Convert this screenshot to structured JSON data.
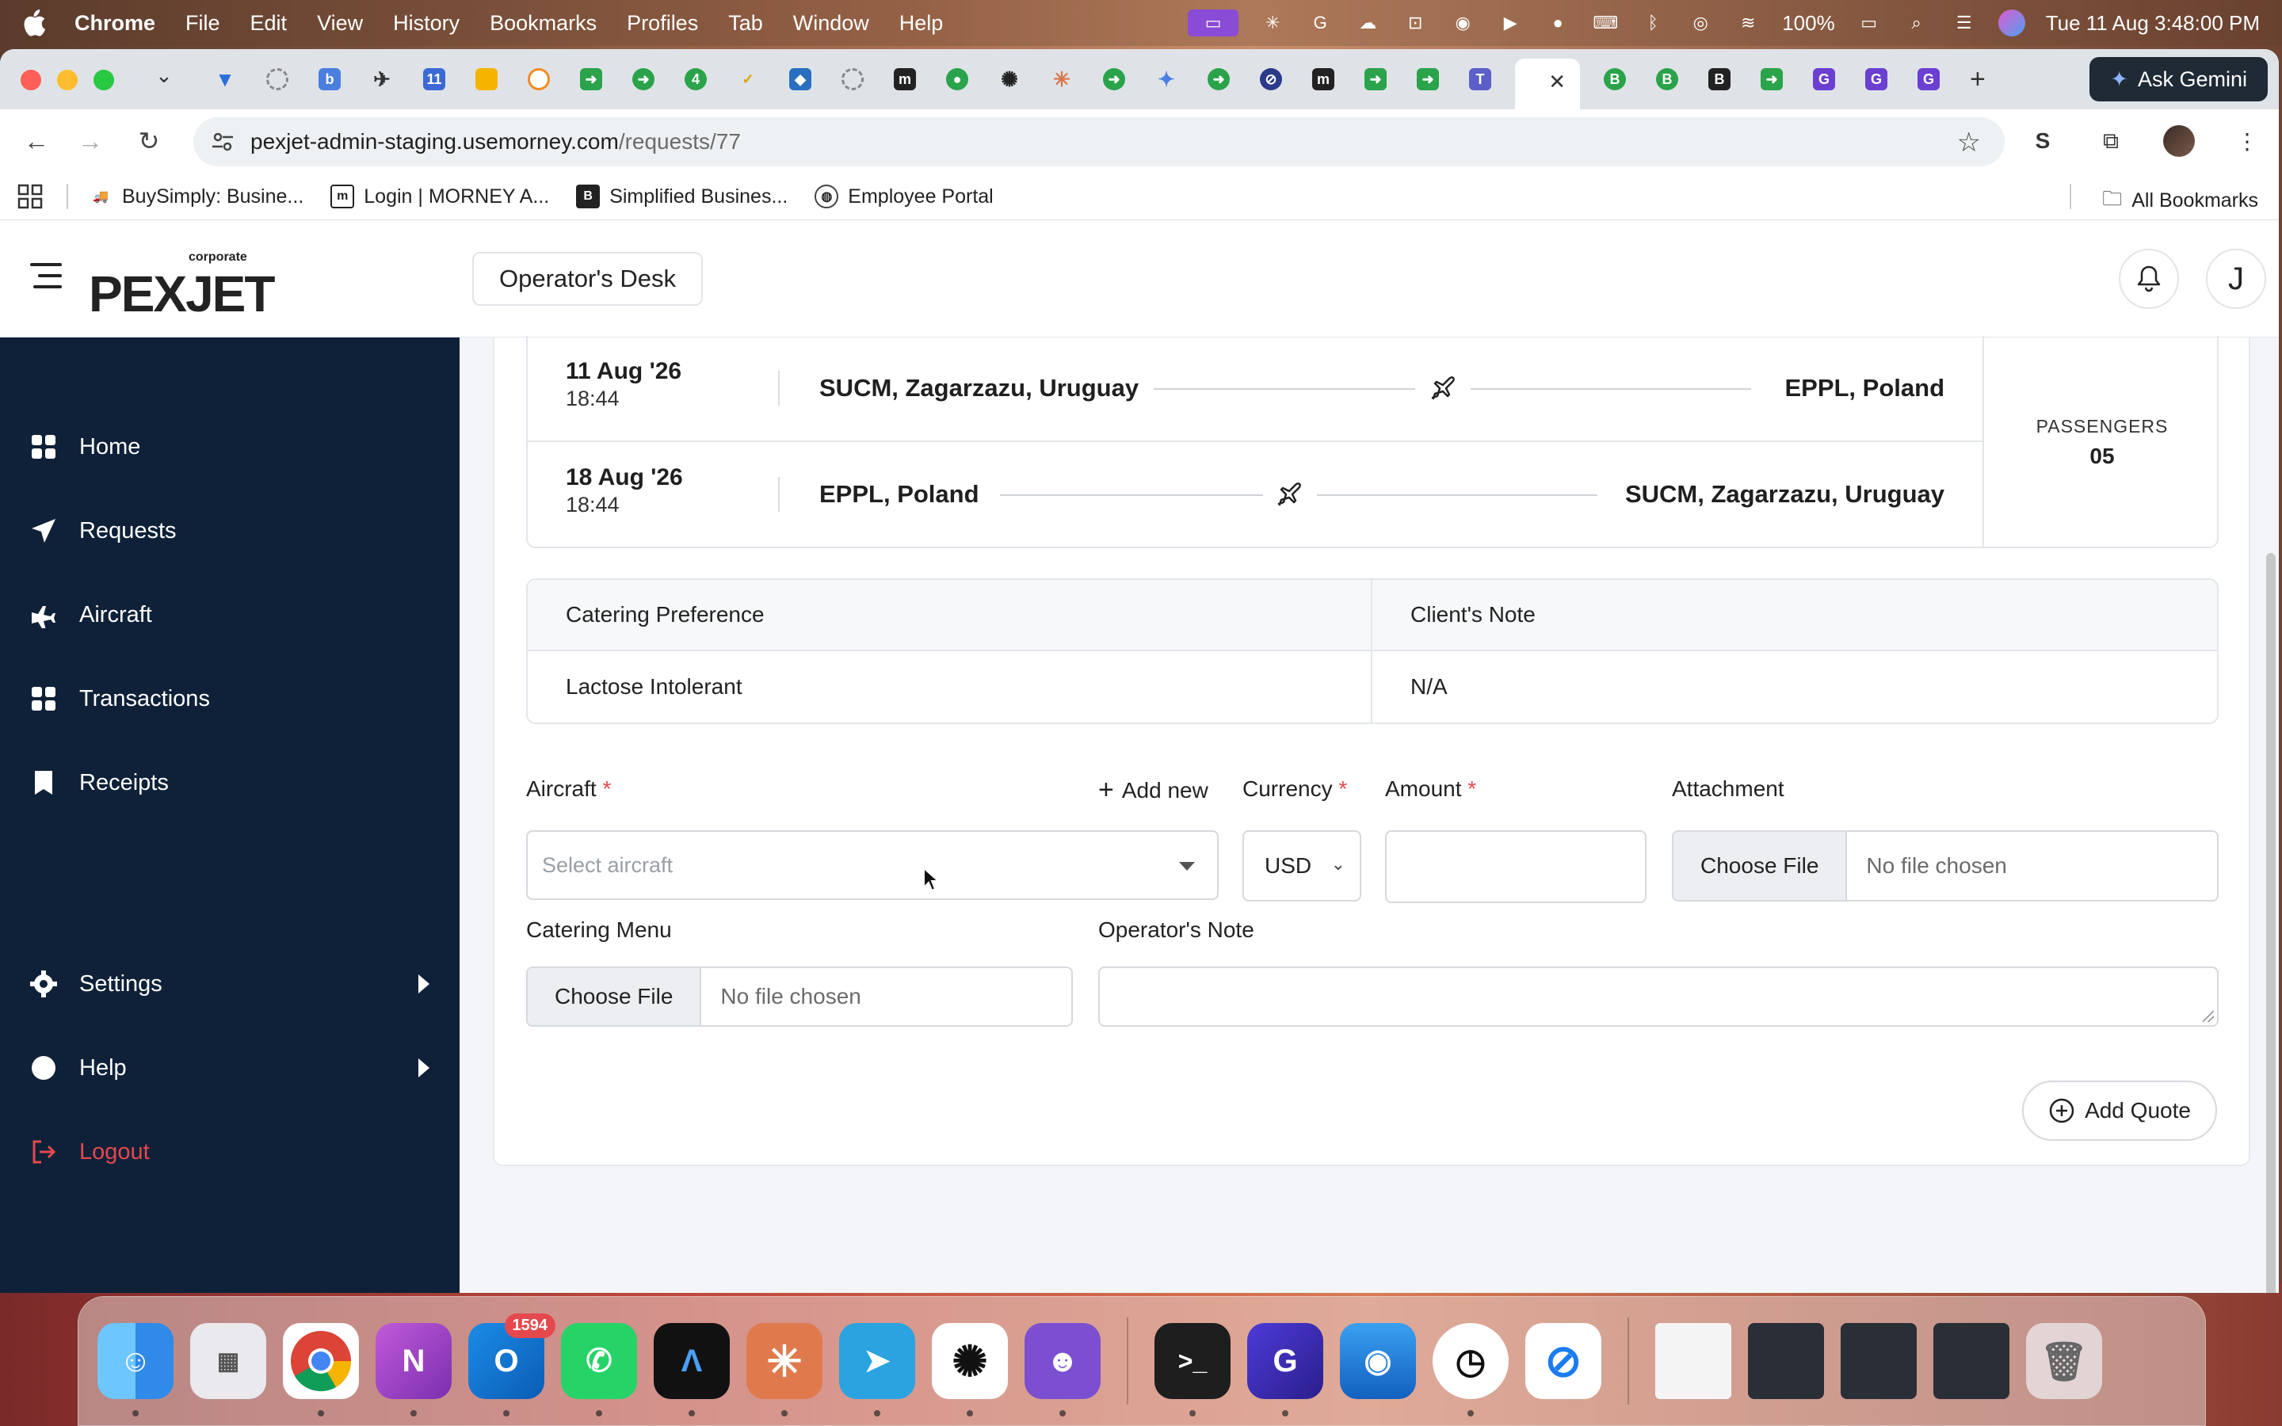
{
  "menubar": {
    "app": "Chrome",
    "menus": [
      "File",
      "Edit",
      "View",
      "History",
      "Bookmarks",
      "Profiles",
      "Tab",
      "Window",
      "Help"
    ],
    "battery": "100%",
    "datetime": "Tue 11 Aug  3:48:00 PM"
  },
  "browser": {
    "gemini_label": "Ask Gemini",
    "url_host": "pexjet-admin-staging.usemorney.com",
    "url_path": "/requests/77",
    "bookmarks": [
      "BuySimply: Busine...",
      "Login | MORNEY A...",
      "Simplified Busines...",
      "Employee Portal"
    ],
    "all_bookmarks": "All Bookmarks"
  },
  "header": {
    "logo_word": "PEXJET",
    "logo_sup": "corporate",
    "desk_button": "Operator's Desk",
    "user_initial": "J"
  },
  "sidebar": {
    "items": [
      {
        "label": "Home",
        "icon": "grid-icon"
      },
      {
        "label": "Requests",
        "icon": "send-icon"
      },
      {
        "label": "Aircraft",
        "icon": "plane-icon"
      },
      {
        "label": "Transactions",
        "icon": "grid-icon"
      },
      {
        "label": "Receipts",
        "icon": "bookmark-icon"
      },
      {
        "label": "Settings",
        "icon": "gear-icon"
      },
      {
        "label": "Help",
        "icon": "circle-icon"
      },
      {
        "label": "Logout",
        "icon": "logout-icon"
      }
    ]
  },
  "flights": {
    "legs": [
      {
        "date": "11 Aug '26",
        "time": "18:44",
        "from": "SUCM, Zagarzazu, Uruguay",
        "to": "EPPL, Poland"
      },
      {
        "date": "18 Aug '26",
        "time": "18:44",
        "from": "EPPL, Poland",
        "to": "SUCM, Zagarzazu, Uruguay"
      }
    ],
    "passengers_label": "PASSENGERS",
    "passengers_value": "05"
  },
  "catering_table": {
    "headers": [
      "Catering Preference",
      "Client's Note"
    ],
    "row": [
      "Lactose Intolerant",
      "N/A"
    ]
  },
  "form": {
    "aircraft_label": "Aircraft",
    "add_new": "Add new",
    "aircraft_placeholder": "Select aircraft",
    "currency_label": "Currency",
    "currency_value": "USD",
    "amount_label": "Amount",
    "required_mark": "*",
    "attachment_label": "Attachment",
    "choose_file": "Choose File",
    "no_file": "No file chosen",
    "catering_menu_label": "Catering Menu",
    "operator_note_label": "Operator's Note",
    "add_quote": "Add Quote"
  },
  "dock": {
    "outlook_badge": "1594"
  },
  "colors": {
    "sidebar_bg": "#0f2138",
    "logout": "#e5484d",
    "required": "#e5484d"
  }
}
